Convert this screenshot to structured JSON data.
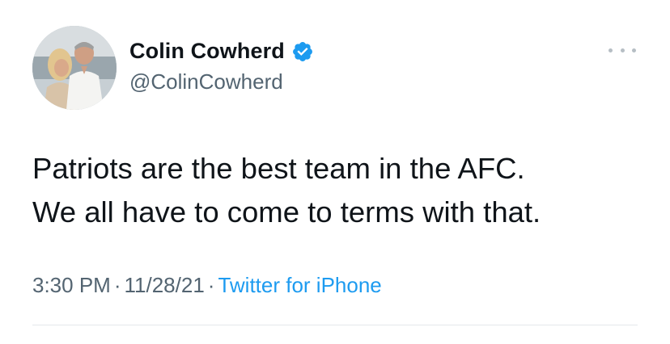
{
  "user": {
    "display_name": "Colin Cowherd",
    "handle": "@ColinCowherd",
    "verified": true
  },
  "tweet": {
    "lines": [
      "Patriots are the best team in the AFC.",
      "We all have to come to terms with that."
    ],
    "time": "3:30 PM",
    "date": "11/28/21",
    "separator": "·",
    "source": "Twitter for iPhone"
  },
  "icons": {
    "verified": "verified-badge-icon",
    "more": "more-options-icon"
  },
  "colors": {
    "verified": "#1d9bf0",
    "link": "#1d9bf0",
    "secondary_text": "#536471"
  }
}
